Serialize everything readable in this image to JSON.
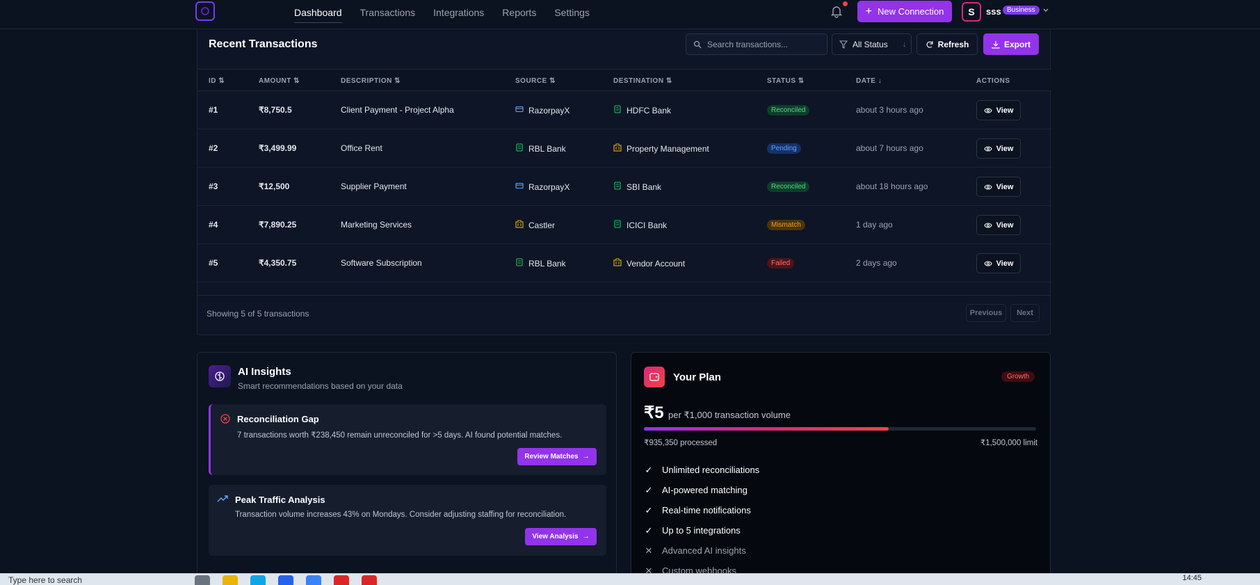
{
  "nav": {
    "links": [
      "Dashboard",
      "Transactions",
      "Integrations",
      "Reports",
      "Settings"
    ],
    "active": "Dashboard",
    "new_connection_label": "New Connection",
    "avatar_initial": "S",
    "username": "sss",
    "plan_badge": "Business"
  },
  "transactions": {
    "title": "Recent Transactions",
    "search_placeholder": "Search transactions...",
    "status_filter": "All Status",
    "refresh_label": "Refresh",
    "export_label": "Export",
    "columns": [
      "ID",
      "AMOUNT",
      "DESCRIPTION",
      "SOURCE",
      "DESTINATION",
      "STATUS",
      "DATE",
      "ACTIONS"
    ],
    "rows": [
      {
        "id": "#1",
        "amount": "₹8,750.5",
        "description": "Client Payment - Project Alpha",
        "source": "RazorpayX",
        "source_icon": "card-icon",
        "destination": "HDFC Bank",
        "dest_icon": "bank-icon",
        "status": "Reconciled",
        "date": "about 3 hours ago",
        "action": "View"
      },
      {
        "id": "#2",
        "amount": "₹3,499.99",
        "description": "Office Rent",
        "source": "RBL Bank",
        "source_icon": "bank-icon",
        "destination": "Property Management",
        "dest_icon": "building-icon",
        "status": "Pending",
        "date": "about 7 hours ago",
        "action": "View"
      },
      {
        "id": "#3",
        "amount": "₹12,500",
        "description": "Supplier Payment",
        "source": "RazorpayX",
        "source_icon": "card-icon",
        "destination": "SBI Bank",
        "dest_icon": "bank-icon",
        "status": "Reconciled",
        "date": "about 18 hours ago",
        "action": "View"
      },
      {
        "id": "#4",
        "amount": "₹7,890.25",
        "description": "Marketing Services",
        "source": "Castler",
        "source_icon": "building-icon",
        "destination": "ICICI Bank",
        "dest_icon": "bank-icon",
        "status": "Mismatch",
        "date": "1 day ago",
        "action": "View"
      },
      {
        "id": "#5",
        "amount": "₹4,350.75",
        "description": "Software Subscription",
        "source": "RBL Bank",
        "source_icon": "bank-icon",
        "destination": "Vendor Account",
        "dest_icon": "building-icon",
        "status": "Failed",
        "date": "2 days ago",
        "action": "View"
      }
    ],
    "showing_text": "Showing 5 of 5 transactions",
    "prev_label": "Previous",
    "next_label": "Next"
  },
  "ai": {
    "title": "AI Insights",
    "subtitle": "Smart recommendations based on your data",
    "insights": [
      {
        "title": "Reconciliation Gap",
        "text": "7 transactions worth ₹238,450 remain unreconciled for >5 days. AI found potential matches.",
        "button": "Review Matches"
      },
      {
        "title": "Peak Traffic Analysis",
        "text": "Transaction volume increases 43% on Mondays. Consider adjusting staffing for reconciliation.",
        "button": "View Analysis"
      }
    ]
  },
  "plan": {
    "title": "Your Plan",
    "tier": "Growth",
    "price": "₹5",
    "price_unit": "per ₹1,000 transaction volume",
    "usage_fraction": 0.6236,
    "processed": "₹935,350 processed",
    "limit": "₹1,500,000 limit",
    "features": [
      {
        "label": "Unlimited reconciliations",
        "included": true
      },
      {
        "label": "AI-powered matching",
        "included": true
      },
      {
        "label": "Real-time notifications",
        "included": true
      },
      {
        "label": "Up to 5 integrations",
        "included": true
      },
      {
        "label": "Advanced AI insights",
        "included": false
      },
      {
        "label": "Custom webhooks",
        "included": false
      }
    ]
  },
  "taskbar": {
    "search_text": "Type here to search",
    "time": "14:45"
  },
  "colors": {
    "accent": "#9333ea",
    "background": "#0b1220"
  }
}
